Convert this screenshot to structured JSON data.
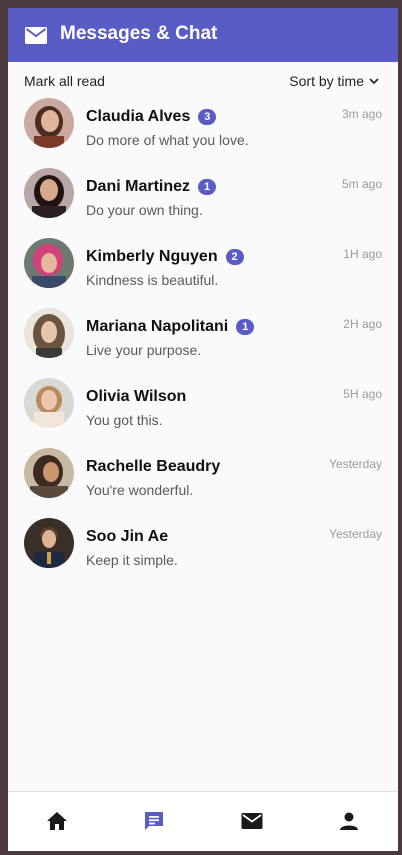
{
  "header": {
    "title": "Messages & Chat",
    "icon": "mail-icon"
  },
  "toolbar": {
    "mark_all_read": "Mark all read",
    "sort_label": "Sort by time"
  },
  "messages": [
    {
      "name": "Claudia Alves",
      "badge": "3",
      "time": "3m ago",
      "text": "Do more of what you love."
    },
    {
      "name": "Dani Martinez",
      "badge": "1",
      "time": "5m ago",
      "text": "Do your own thing."
    },
    {
      "name": "Kimberly Nguyen",
      "badge": "2",
      "time": "1H ago",
      "text": "Kindness is beautiful."
    },
    {
      "name": "Mariana Napolitani",
      "badge": "1",
      "time": "2H ago",
      "text": "Live your purpose."
    },
    {
      "name": "Olivia Wilson",
      "badge": "",
      "time": "5H ago",
      "text": "You got this."
    },
    {
      "name": "Rachelle Beaudry",
      "badge": "",
      "time": "Yesterday",
      "text": "You're wonderful."
    },
    {
      "name": "Soo Jin Ae",
      "badge": "",
      "time": "Yesterday",
      "text": "Keep it simple."
    }
  ],
  "bottom_nav": [
    {
      "icon": "home-icon",
      "active": false
    },
    {
      "icon": "chat-icon",
      "active": true
    },
    {
      "icon": "mail-icon",
      "active": false
    },
    {
      "icon": "profile-icon",
      "active": false
    }
  ],
  "colors": {
    "accent": "#5a5cc6",
    "background": "#fafafa",
    "time": "#9a9a9a"
  }
}
